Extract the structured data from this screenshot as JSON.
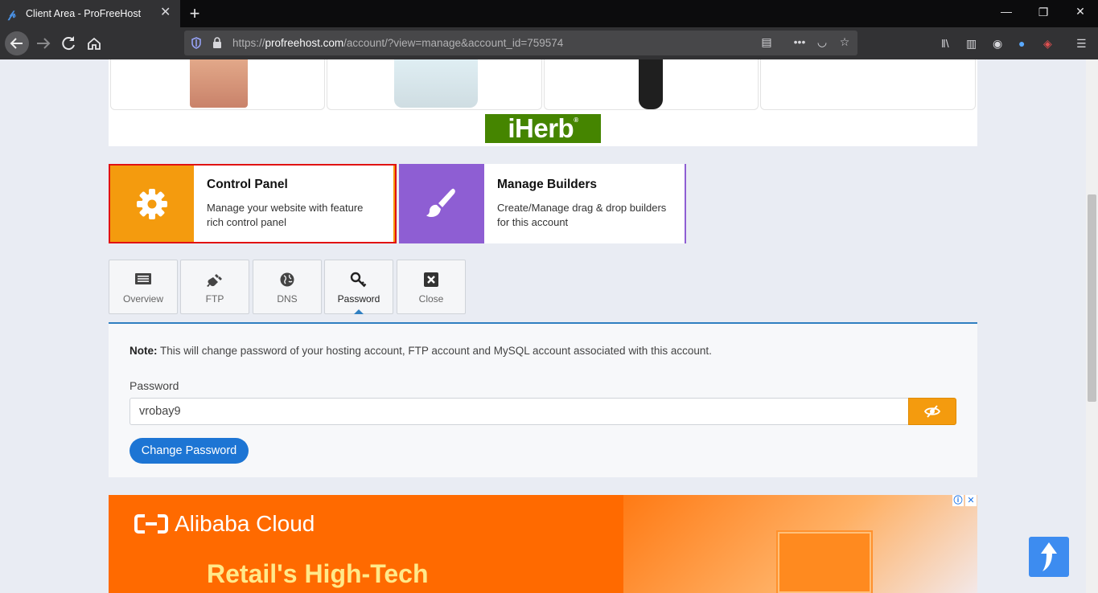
{
  "browser": {
    "tab_title": "Client Area - ProFreeHost",
    "url_prefix": "https://",
    "url_domain": "profreehost.com",
    "url_path": "/account/?view=manage&account_id=759574"
  },
  "ad_top": {
    "brand": "iHerb",
    "brand_mark": "®",
    "brand_color": "#458500"
  },
  "cards": {
    "control_panel": {
      "title": "Control Panel",
      "description": "Manage your website with feature rich control panel",
      "color": "#f49b0e"
    },
    "manage_builders": {
      "title": "Manage Builders",
      "description": "Create/Manage drag & drop builders for this account",
      "color": "#8e5ed3"
    }
  },
  "tabs": [
    {
      "label": "Overview",
      "icon": "list-icon"
    },
    {
      "label": "FTP",
      "icon": "plug-icon"
    },
    {
      "label": "DNS",
      "icon": "globe-icon"
    },
    {
      "label": "Password",
      "icon": "key-icon",
      "active": true
    },
    {
      "label": "Close",
      "icon": "close-box-icon"
    }
  ],
  "password_panel": {
    "note_label": "Note:",
    "note_text": " This will change password of your hosting account, FTP account and MySQL account associated with this account.",
    "field_label": "Password",
    "field_value": "vrobay9",
    "submit_label": "Change Password",
    "accent_color": "#1d75d4"
  },
  "ad_bottom": {
    "brand": "Alibaba Cloud",
    "headline": "Retail's High-Tech",
    "background_color": "#ff6a00"
  }
}
